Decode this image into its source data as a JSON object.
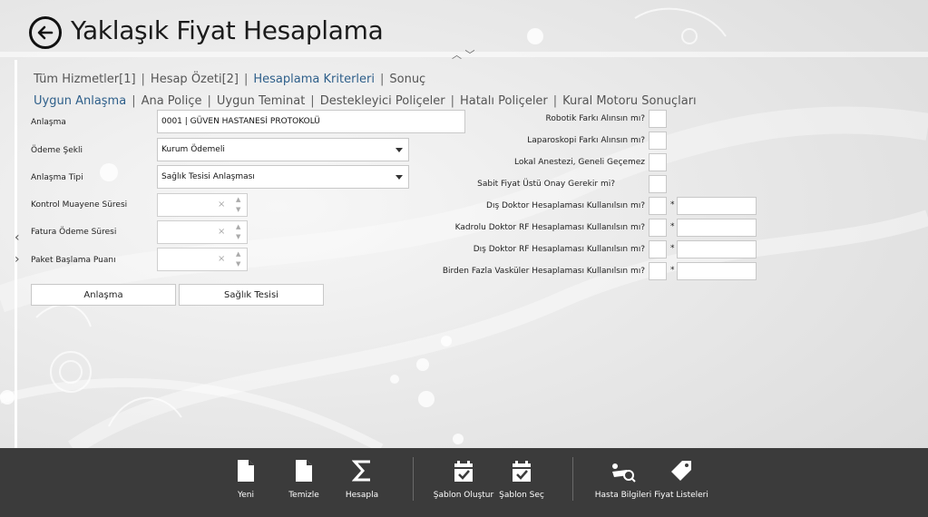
{
  "page": {
    "title": "Yaklaşık Fiyat Hesaplama"
  },
  "nav_primary": [
    {
      "label": "Tüm Hizmetler[1]",
      "active": false
    },
    {
      "label": "Hesap Özeti[2]",
      "active": false
    },
    {
      "label": "Hesaplama Kriterleri",
      "active": true
    },
    {
      "label": "Sonuç",
      "active": false
    }
  ],
  "nav_secondary": [
    {
      "label": "Uygun Anlaşma",
      "active": true
    },
    {
      "label": "Ana Poliçe",
      "active": false
    },
    {
      "label": "Uygun Teminat",
      "active": false
    },
    {
      "label": "Destekleyici Poliçeler",
      "active": false
    },
    {
      "label": "Hatalı Poliçeler",
      "active": false
    },
    {
      "label": "Kural Motoru Sonuçları",
      "active": false
    }
  ],
  "nav_separator": "|",
  "form": {
    "anlasma_label": "Anlaşma",
    "anlasma_value": "0001 | GÜVEN HASTANESİ PROTOKOLÜ",
    "odeme_sekli_label": "Ödeme Şekli",
    "odeme_sekli_value": "Kurum Ödemeli",
    "anlasma_tipi_label": "Anlaşma Tipi",
    "anlasma_tipi_value": "Sağlık Tesisi Anlaşması",
    "kontrol_label": "Kontrol Muayene Süresi",
    "fatura_label": "Fatura Ödeme Süresi",
    "paket_label": "Paket Başlama Puanı",
    "clear_glyph": "×",
    "up_glyph": "▲",
    "down_glyph": "▼",
    "anlasma_button": "Anlaşma",
    "saglik_tesisi_button": "Sağlık Tesisi"
  },
  "criteria": {
    "robotik": "Robotik Farkı Alınsın mı?",
    "laparoskopi": "Laparoskopi Farkı Alınsın mı?",
    "lokal": "Lokal Anestezi, Geneli Geçemez",
    "sabit": "Sabit Fiyat Üstü Onay Gerekir mi?",
    "dis_doktor": "Dış Doktor Hesaplaması Kullanılsın mı?",
    "kadrolu_rf": "Kadrolu Doktor RF Hesaplaması Kullanılsın mı?",
    "dis_doktor_rf": "Dış Doktor RF Hesaplaması Kullanılsın mı?",
    "vaskuler": "Birden Fazla Vasküler Hesaplaması Kullanılsın mı?",
    "star": "*"
  },
  "appbar": {
    "yeni": "Yeni",
    "temizle": "Temizle",
    "hesapla": "Hesapla",
    "sablon_olustur": "Şablon Oluştur",
    "sablon_sec": "Şablon Seç",
    "hasta_bilgileri": "Hasta Bilgileri",
    "fiyat_listeleri": "Fiyat Listeleri"
  },
  "icons": {
    "back": "back-arrow-icon",
    "new": "document-icon",
    "clear": "document-icon",
    "calculate": "sigma-icon",
    "template_create": "calendar-check-icon",
    "template_select": "calendar-check-icon",
    "patient": "patient-search-icon",
    "price": "price-tag-icon"
  },
  "colors": {
    "active_link": "#2e5f8a",
    "appbar_bg": "#3b3b3b"
  }
}
